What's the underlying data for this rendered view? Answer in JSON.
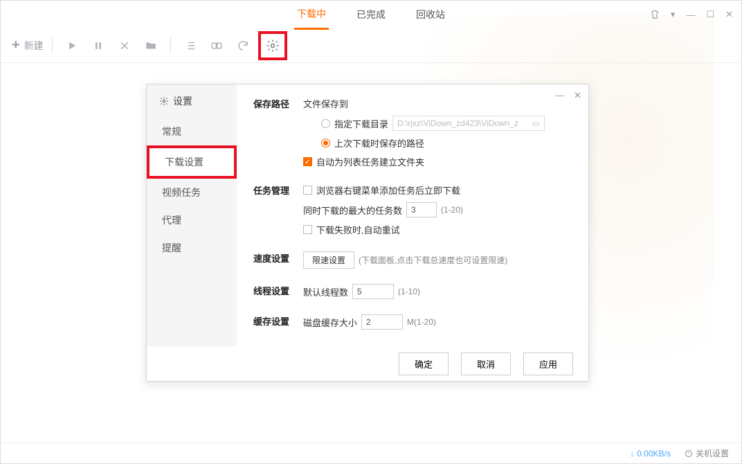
{
  "tabs": {
    "downloading": "下载中",
    "finished": "已完成",
    "recycle": "回收站"
  },
  "toolbar": {
    "new": "新建"
  },
  "dialog": {
    "title": "设置",
    "sidebar": {
      "general": "常规",
      "download": "下载设置",
      "video": "视频任务",
      "proxy": "代理",
      "remind": "提醒"
    },
    "savePath": {
      "label": "保存路径",
      "fileSaveTo": "文件保存到",
      "optSpecify": "指定下载目录",
      "pathValue": "D:\\rjxz\\ViDown_zd423\\ViDown_z",
      "optLast": "上次下载时保存的路径",
      "autoFolder": "自动为列表任务建立文件夹"
    },
    "taskMgmt": {
      "label": "任务管理",
      "browserCtx": "浏览器右键菜单添加任务后立即下载",
      "maxTasksLabel": "同时下载的最大的任务数",
      "maxTasksValue": "3",
      "maxTasksRange": "(1-20)",
      "retry": "下载失败时,自动重试"
    },
    "speed": {
      "label": "速度设置",
      "btn": "限速设置",
      "hint": "(下载面板,点击下载总速度也可设置限速)"
    },
    "thread": {
      "label": "线程设置",
      "defaultLabel": "默认线程数",
      "value": "5",
      "range": "(1-10)"
    },
    "cache": {
      "label": "缓存设置",
      "diskLabel": "磁盘缓存大小",
      "value": "2",
      "range": "M(1-20)"
    },
    "buttons": {
      "ok": "确定",
      "cancel": "取消",
      "apply": "应用"
    }
  },
  "status": {
    "speed": "0.00KB/s",
    "shutdown": "关机设置"
  }
}
